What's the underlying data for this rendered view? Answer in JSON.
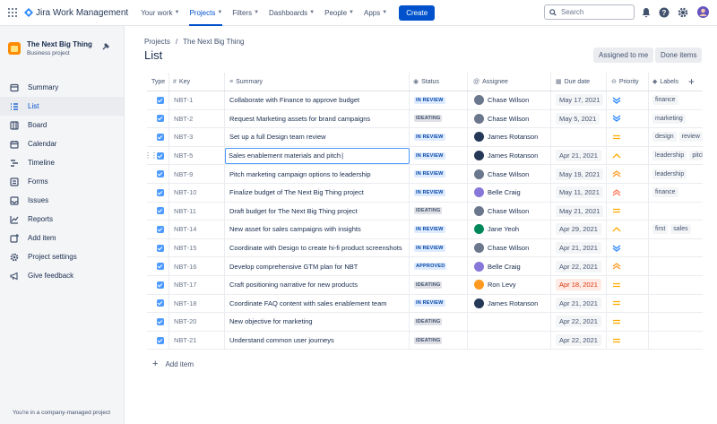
{
  "topnav": {
    "product_name": "Jira Work Management",
    "items": [
      {
        "label": "Your work"
      },
      {
        "label": "Projects"
      },
      {
        "label": "Filters"
      },
      {
        "label": "Dashboards"
      },
      {
        "label": "People"
      },
      {
        "label": "Apps"
      }
    ],
    "create_label": "Create",
    "search_placeholder": "Search"
  },
  "sidebar": {
    "project_name": "The Next Big Thing",
    "project_type": "Business project",
    "items": [
      {
        "label": "Summary",
        "icon": "summary-icon"
      },
      {
        "label": "List",
        "icon": "list-icon"
      },
      {
        "label": "Board",
        "icon": "board-icon"
      },
      {
        "label": "Calendar",
        "icon": "calendar-icon"
      },
      {
        "label": "Timeline",
        "icon": "timeline-icon"
      },
      {
        "label": "Forms",
        "icon": "forms-icon"
      },
      {
        "label": "Issues",
        "icon": "issues-icon"
      },
      {
        "label": "Reports",
        "icon": "reports-icon"
      },
      {
        "label": "Add item",
        "icon": "add-item-icon"
      },
      {
        "label": "Project settings",
        "icon": "settings-icon"
      },
      {
        "label": "Give feedback",
        "icon": "megaphone-icon"
      }
    ],
    "footer": "You're in a company-managed project"
  },
  "main": {
    "breadcrumb": [
      "Projects",
      "The Next Big Thing"
    ],
    "breadcrumb_sep": "/",
    "title": "List",
    "assigned_label": "Assigned to me",
    "done_label": "Done items",
    "add_item_label": "Add item"
  },
  "table": {
    "headers": {
      "type": "Type",
      "key": "Key",
      "summary": "Summary",
      "status": "Status",
      "assignee": "Assignee",
      "due": "Due date",
      "priority": "Priority",
      "labels": "Labels"
    },
    "rows": [
      {
        "key": "NBT-1",
        "summary": "Collaborate with Finance to approve budget",
        "status": "IN REVIEW",
        "assignee": "Chase Wilson",
        "due": "May 17, 2021",
        "priority": "lowest",
        "labels": [
          "finance"
        ]
      },
      {
        "key": "NBT-2",
        "summary": "Request Marketing assets for brand campaigns",
        "status": "IDEATING",
        "assignee": "Chase Wilson",
        "due": "May 5, 2021",
        "priority": "lowest",
        "labels": [
          "marketing"
        ]
      },
      {
        "key": "NBT-3",
        "summary": "Set up a full Design team review",
        "status": "IN REVIEW",
        "assignee": "James Rotanson",
        "due": "",
        "priority": "medium",
        "labels": [
          "design",
          "review"
        ]
      },
      {
        "key": "NBT-5",
        "summary": "Sales enablement materials and pitch",
        "status": "IN REVIEW",
        "assignee": "James Rotanson",
        "due": "Apr 21, 2021",
        "priority": "low",
        "labels": [
          "leadership",
          "pitch"
        ],
        "editing": true
      },
      {
        "key": "NBT-9",
        "summary": "Pitch marketing campaign options to leadership",
        "status": "IN REVIEW",
        "assignee": "Chase Wilson",
        "due": "May 19, 2021",
        "priority": "high",
        "labels": [
          "leadership"
        ]
      },
      {
        "key": "NBT-10",
        "summary": "Finalize budget of The Next Big Thing project",
        "status": "IN REVIEW",
        "assignee": "Belle Craig",
        "due": "May 11, 2021",
        "priority": "highest",
        "labels": [
          "finance"
        ]
      },
      {
        "key": "NBT-11",
        "summary": "Draft budget for The Next Big Thing project",
        "status": "IDEATING",
        "assignee": "Chase Wilson",
        "due": "May 21, 2021",
        "priority": "medium",
        "labels": []
      },
      {
        "key": "NBT-14",
        "summary": "New asset for sales campaigns with insights",
        "status": "IN REVIEW",
        "assignee": "Jane Yeoh",
        "due": "Apr 29, 2021",
        "priority": "low",
        "labels": [
          "first",
          "sales"
        ]
      },
      {
        "key": "NBT-15",
        "summary": "Coordinate with Design to create hi-fi product screenshots",
        "status": "IN REVIEW",
        "assignee": "Chase Wilson",
        "due": "Apr 21, 2021",
        "priority": "lowest",
        "labels": []
      },
      {
        "key": "NBT-16",
        "summary": "Develop comprehensive GTM plan for NBT",
        "status": "APPROVED",
        "assignee": "Belle Craig",
        "due": "Apr 22, 2021",
        "priority": "high",
        "labels": []
      },
      {
        "key": "NBT-17",
        "summary": "Craft positioning narrative for new products",
        "status": "IDEATING",
        "assignee": "Ron Levy",
        "due": "Apr 18, 2021",
        "priority": "medium",
        "labels": [],
        "overdue": true
      },
      {
        "key": "NBT-18",
        "summary": "Coordinate FAQ content with sales enablement team",
        "status": "IN REVIEW",
        "assignee": "James Rotanson",
        "due": "Apr 21, 2021",
        "priority": "medium",
        "labels": []
      },
      {
        "key": "NBT-20",
        "summary": "New objective for marketing",
        "status": "IDEATING",
        "assignee": "",
        "due": "Apr 22, 2021",
        "priority": "medium",
        "labels": []
      },
      {
        "key": "NBT-21",
        "summary": "Understand common user journeys",
        "status": "IDEATING",
        "assignee": "",
        "due": "Apr 22, 2021",
        "priority": "medium",
        "labels": []
      }
    ]
  },
  "colors": {
    "brand": "#0052cc",
    "priority_high": "#ff7452",
    "priority_medium": "#ffab00",
    "priority_low": "#2684ff"
  }
}
